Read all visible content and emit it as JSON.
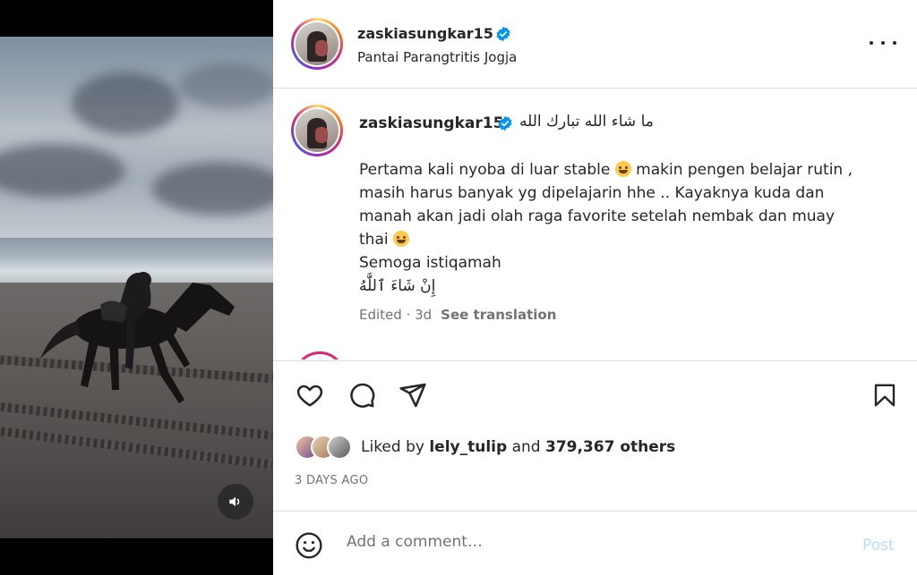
{
  "post": {
    "username": "zaskiasungkar15",
    "location": "Pantai Parangtritis Jogja"
  },
  "caption": {
    "username": "zaskiasungkar15",
    "arabic_heading": "ما شاء الله تبارك الله",
    "line1_a": "Pertama kali nyoba di luar stable",
    "line1_b": "makin pengen belajar rutin ,",
    "line2": "masih harus banyak yg dipelajarin hhe .. Kayaknya kuda dan",
    "line3": "manah akan jadi olah raga favorite setelah nembak dan muay",
    "line4": "thai",
    "line5": "Semoga istiqamah",
    "line6": "إِنْ شَاءَ ٱللَّٰهُ",
    "edited": "Edited · 3d",
    "see_translation": "See translation"
  },
  "likes": {
    "prefix": "Liked by",
    "user": "lely_tulip",
    "connector": "and",
    "others": "379,367 others"
  },
  "date": "3 DAYS AGO",
  "comment": {
    "placeholder": "Add a comment…",
    "post_label": "Post"
  },
  "colors": {
    "verified": "#0095f6",
    "post_button": "#b2dffc",
    "secondary_text": "#737373",
    "border": "#dbdbdb"
  },
  "icons": {
    "like": "heart-icon",
    "comment": "comment-icon",
    "share": "paper-plane-icon",
    "save": "bookmark-icon",
    "emoji": "smiley-icon",
    "sound": "speaker-icon",
    "more": "more-options-icon"
  }
}
